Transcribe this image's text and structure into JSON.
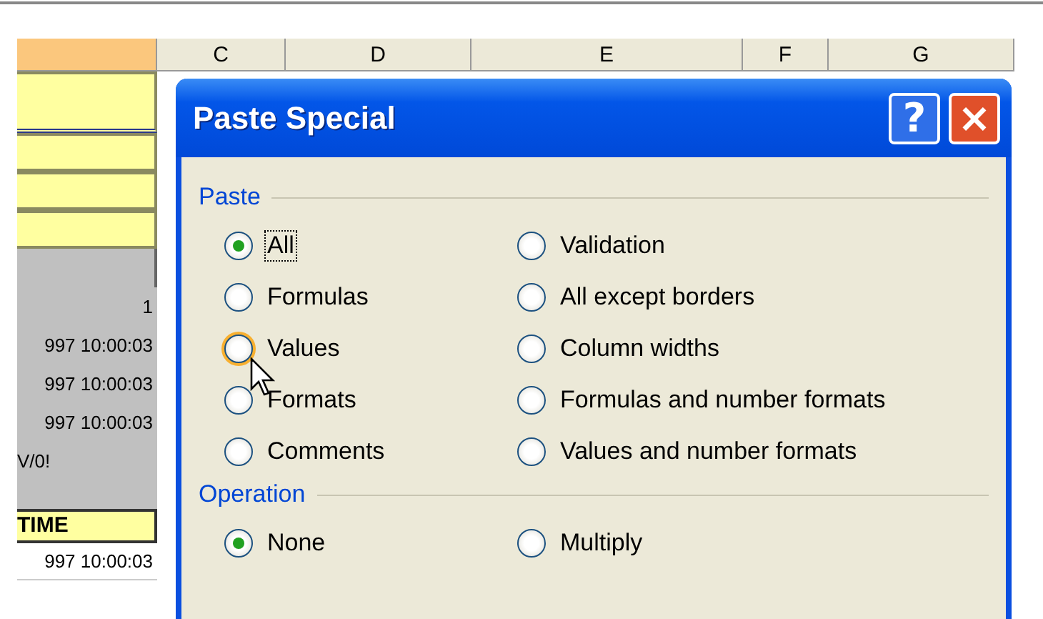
{
  "sheet": {
    "column_headers": [
      {
        "selected": true
      },
      {
        "label": "C",
        "selected": false
      },
      {
        "label": "D",
        "selected": false
      },
      {
        "label": "E",
        "selected": false
      },
      {
        "label": "F",
        "selected": false
      },
      {
        "label": "G",
        "selected": false
      }
    ],
    "cells": [
      {
        "kind": "input",
        "tall": true
      },
      {
        "kind": "input"
      },
      {
        "kind": "input"
      },
      {
        "kind": "input"
      },
      {
        "kind": "blank"
      },
      {
        "kind": "value",
        "text": "1"
      },
      {
        "kind": "value",
        "text": "997 10:00:03"
      },
      {
        "kind": "value",
        "text": "997 10:00:03"
      },
      {
        "kind": "value",
        "text": "997 10:00:03"
      },
      {
        "kind": "error",
        "text": "V/0!"
      },
      {
        "kind": "spacer"
      },
      {
        "kind": "heading",
        "text": "TIME"
      },
      {
        "kind": "plain",
        "text": "997 10:00:03"
      }
    ]
  },
  "dialog": {
    "title": "Paste Special",
    "help": "?",
    "close": "×",
    "groups": [
      {
        "label": "Paste",
        "options": [
          {
            "label": "All",
            "selected": true,
            "focused": true,
            "hover": false
          },
          {
            "label": "Validation",
            "selected": false,
            "focused": false,
            "hover": false
          },
          {
            "label": "Formulas",
            "selected": false,
            "focused": false,
            "hover": false
          },
          {
            "label": "All except borders",
            "selected": false,
            "focused": false,
            "hover": false
          },
          {
            "label": "Values",
            "selected": false,
            "focused": false,
            "hover": true
          },
          {
            "label": "Column widths",
            "selected": false,
            "focused": false,
            "hover": false
          },
          {
            "label": "Formats",
            "selected": false,
            "focused": false,
            "hover": false
          },
          {
            "label": "Formulas and number formats",
            "selected": false,
            "focused": false,
            "hover": false
          },
          {
            "label": "Comments",
            "selected": false,
            "focused": false,
            "hover": false
          },
          {
            "label": "Values and number formats",
            "selected": false,
            "focused": false,
            "hover": false
          }
        ]
      },
      {
        "label": "Operation",
        "options": [
          {
            "label": "None",
            "selected": true,
            "focused": false,
            "hover": false
          },
          {
            "label": "Multiply",
            "selected": false,
            "focused": false,
            "hover": false
          }
        ]
      }
    ]
  }
}
